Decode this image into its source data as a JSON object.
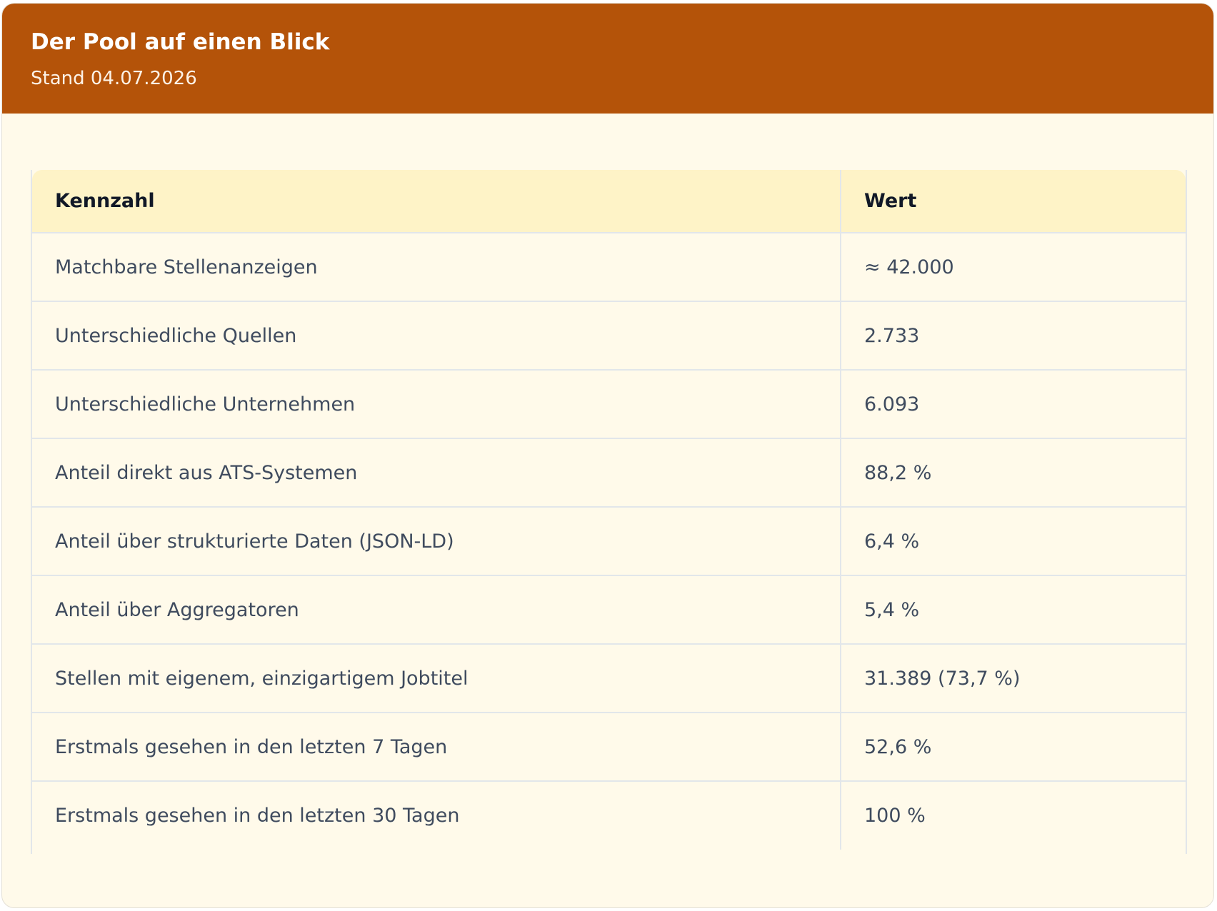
{
  "header": {
    "title": "Der Pool auf einen Blick",
    "subtitle": "Stand 04.07.2026",
    "color": "#b45309"
  },
  "table": {
    "columns": [
      "Kennzahl",
      "Wert"
    ],
    "rows": [
      {
        "metric": "Matchbare Stellenanzeigen",
        "value": "≈ 42.000"
      },
      {
        "metric": "Unterschiedliche Quellen",
        "value": "2.733"
      },
      {
        "metric": "Unterschiedliche Unternehmen",
        "value": "6.093"
      },
      {
        "metric": "Anteil direkt aus ATS-Systemen",
        "value": "88,2 %"
      },
      {
        "metric": "Anteil über strukturierte Daten (JSON-LD)",
        "value": "6,4 %"
      },
      {
        "metric": "Anteil über Aggregatoren",
        "value": "5,4 %"
      },
      {
        "metric": "Stellen mit eigenem, einzigartigem Jobtitel",
        "value": "31.389 (73,7 %)"
      },
      {
        "metric": "Erstmals gesehen in den letzten 7 Tagen",
        "value": "52,6 %"
      },
      {
        "metric": "Erstmals gesehen in den letzten 30 Tagen",
        "value": "100 %"
      }
    ]
  }
}
